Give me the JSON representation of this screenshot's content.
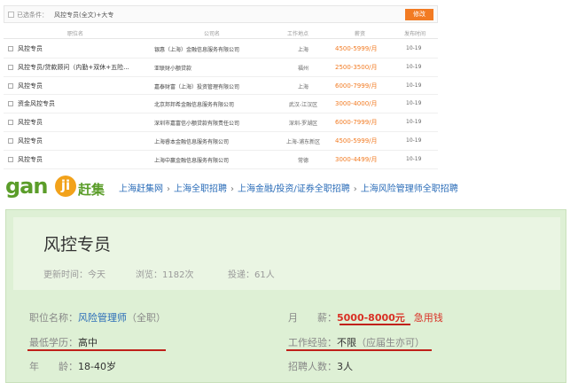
{
  "filter": {
    "label": "已选条件：",
    "value": "风控专员(全文)+大专",
    "button": "修改"
  },
  "table": {
    "headers": [
      "职位名",
      "公司名",
      "工作地点",
      "薪资",
      "发布时间"
    ],
    "rows": [
      {
        "title": "风控专员",
        "company": "银惠（上海）金融信息服务有限公司",
        "location": "上海",
        "salary": "4500-5999/月",
        "date": "10-19"
      },
      {
        "title": "风控专员/贷款顾问（内勤+双休+五险...",
        "company": "亚联财小额贷款",
        "location": "福州",
        "salary": "2500-3500/月",
        "date": "10-19"
      },
      {
        "title": "风控专员",
        "company": "嘉泰财富（上海）投资管理有限公司",
        "location": "上海",
        "salary": "6000-7999/月",
        "date": "10-19"
      },
      {
        "title": "资金风控专员",
        "company": "北京邦邦希金融信息服务有限公司",
        "location": "武汉-江汉区",
        "salary": "3000-4000/月",
        "date": "10-19"
      },
      {
        "title": "风控专员",
        "company": "深圳市嘉富信小额贷款有限责任公司",
        "location": "深圳-罗湖区",
        "salary": "6000-7999/月",
        "date": "10-19"
      },
      {
        "title": "风控专员",
        "company": "上海睿本金融信息服务有限公司",
        "location": "上海-浦东新区",
        "salary": "4500-5999/月",
        "date": "10-19"
      },
      {
        "title": "风控专员",
        "company": "上海中赢金融信息服务有限公司",
        "location": "常德",
        "salary": "3000-4499/月",
        "date": "10-19"
      }
    ]
  },
  "logo": {
    "latin": "gan",
    "badge": "ji",
    "chinese": "赶集"
  },
  "breadcrumb": [
    "上海赶集网",
    "上海全职招聘",
    "上海金融/投资/证券全职招聘",
    "上海风险管理师全职招聘"
  ],
  "job": {
    "title": "风控专员",
    "updated_label": "更新时间：",
    "updated_value": "今天",
    "views_label": "浏览：",
    "views_value": "1182次",
    "applies_label": "投递：",
    "applies_value": "61人"
  },
  "fields": {
    "position_label": "职位名称：",
    "position_value": "风险管理师",
    "position_type": "（全职）",
    "salary_label": "月　　薪：",
    "salary_value": "5000-8000元",
    "urgent": "急用钱",
    "education_label": "最低学历：",
    "education_value": "高中",
    "experience_label": "工作经验：",
    "experience_value": "不限",
    "experience_note": "（应届生亦可）",
    "age_label": "年　　龄：",
    "age_value": "18-40岁",
    "headcount_label": "招聘人数：",
    "headcount_value": "3人"
  },
  "colors": {
    "accent": "#f27b23",
    "brand_green": "#5b9d2a",
    "link": "#2a6cb8",
    "alert_red": "#d93025"
  }
}
